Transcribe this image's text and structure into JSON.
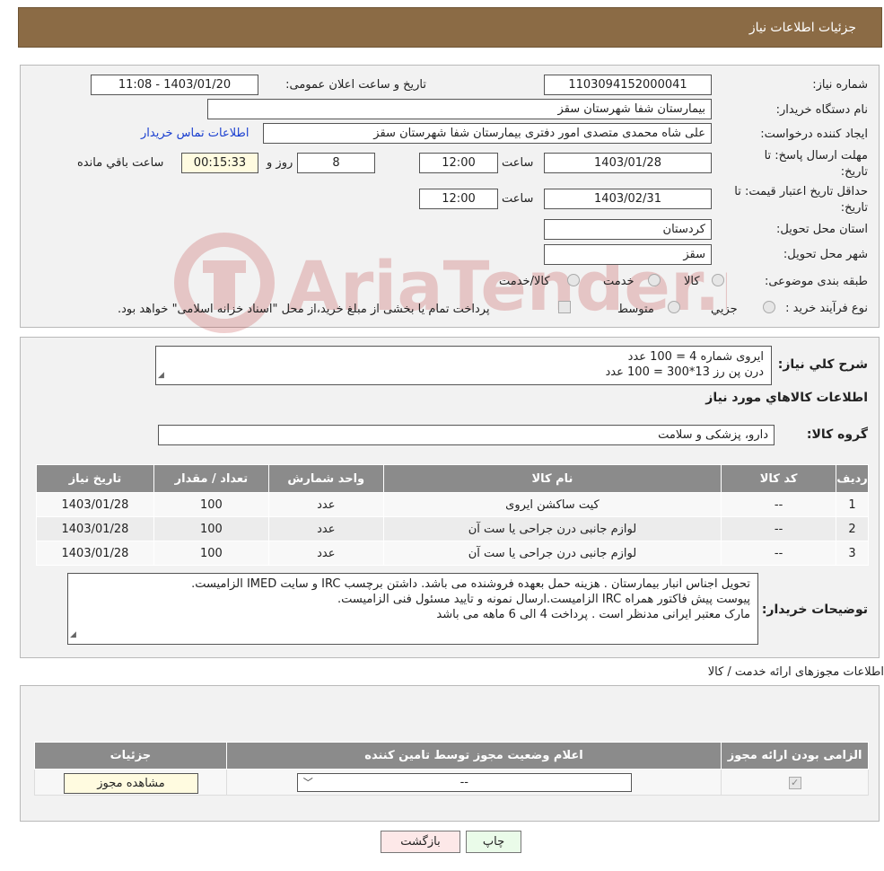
{
  "header": {
    "title": "جزئیات اطلاعات نیاز"
  },
  "watermark": {
    "text": "AriaTender.neT"
  },
  "details": {
    "need_number_label": "شماره نیاز:",
    "need_number": "1103094152000041",
    "announce_label": "تاریخ و ساعت اعلان عمومی:",
    "announce_value": "1403/01/20 - 11:08",
    "buyer_org_label": "نام دستگاه خریدار:",
    "buyer_org": "بیمارستان شفا شهرستان سقز",
    "requester_label": "ایجاد کننده درخواست:",
    "requester": "علی شاه محمدی متصدی امور دفتری بیمارستان شفا شهرستان سقز",
    "contact_link": "اطلاعات تماس خریدار",
    "deadline_label_1": "مهلت ارسال پاسخ: تا",
    "deadline_label_2": "تاریخ:",
    "deadline_date": "1403/01/28",
    "time_label": "ساعت",
    "deadline_time": "12:00",
    "days_value": "8",
    "days_label": "روز و",
    "remaining_time": "00:15:33",
    "remaining_label": "ساعت باقي مانده",
    "validity_label_1": "حداقل تاریخ اعتبار قیمت: تا",
    "validity_label_2": "تاریخ:",
    "validity_date": "1403/02/31",
    "validity_time": "12:00",
    "province_label": "استان محل تحویل:",
    "province": "کردستان",
    "city_label": "شهر محل تحویل:",
    "city": "سقز",
    "category_label": "طبقه بندی موضوعی:",
    "category_options": [
      "کالا",
      "خدمت",
      "کالا/خدمت"
    ],
    "process_label": "نوع فرآیند خرید :",
    "process_options": [
      "جزیي",
      "متوسط"
    ],
    "payment_note": "پرداخت تمام یا بخشی از مبلغ خرید،از محل \"اسناد خزانه اسلامی\" خواهد بود."
  },
  "summary": {
    "description_label": "شرح کلي نياز:",
    "description_lines": [
      "ایروی شماره 4 = 100 عدد",
      "درن پن رز 13*300 = 100 عدد"
    ],
    "items_heading": "اطلاعات کالاهاي مورد نياز",
    "group_label": "گروه کالا:",
    "group_value": "دارو، پزشکی و سلامت"
  },
  "items_table": {
    "headers": [
      "رديف",
      "کد کالا",
      "نام کالا",
      "واحد شمارش",
      "تعداد / مقدار",
      "تاریخ نیاز"
    ],
    "rows": [
      [
        "1",
        "--",
        "کیت ساکشن ایروی",
        "عدد",
        "100",
        "1403/01/28"
      ],
      [
        "2",
        "--",
        "لوازم جانبی درن جراحی یا ست آن",
        "عدد",
        "100",
        "1403/01/28"
      ],
      [
        "3",
        "--",
        "لوازم جانبی درن جراحی یا ست آن",
        "عدد",
        "100",
        "1403/01/28"
      ]
    ]
  },
  "buyer_notes": {
    "label": "توضیحات خریدار:",
    "lines": [
      "تحویل اجناس  انبار بیمارستان . هزینه حمل بعهده فروشنده می باشد.  داشتن برچسب IRC  و سایت  IMED  الزامیست.",
      "پیوست پیش فاکتور همراه IRC  الزامیست.ارسال نمونه و تایید مسئول فنی الزامیست.",
      "مارک معتبر ایرانی مدنظر است . پرداخت 4 الی 6 ماهه می باشد"
    ]
  },
  "permits": {
    "heading": "اطلاعات مجوزهای ارائه خدمت / کالا",
    "headers": [
      "الزامی بودن ارائه مجوز",
      "اعلام وضعیت مجوز توسط تامین کننده",
      "جزئیات"
    ],
    "select_value": "--",
    "view_button": "مشاهده مجوز"
  },
  "footer": {
    "print_button": "چاپ",
    "back_button": "بازگشت"
  }
}
